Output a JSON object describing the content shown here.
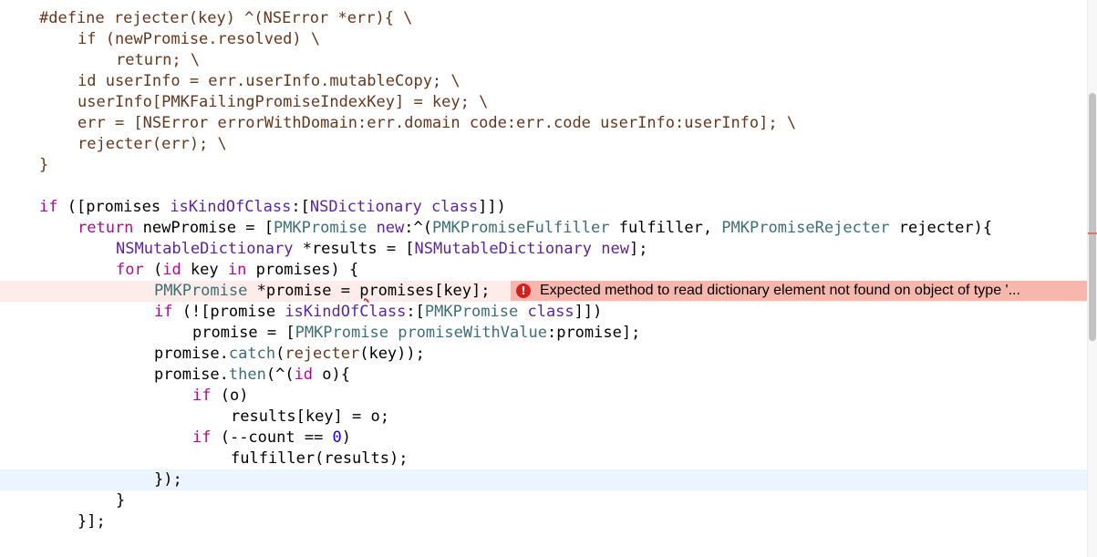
{
  "colors": {
    "error_line_bg": "#fdecea",
    "error_banner_bg": "#f7b7ad",
    "error_icon": "#d61f1f",
    "current_line_bg": "#ecf5ff",
    "preprocessor": "#643820",
    "keyword": "#aa0d91",
    "type": "#5c2699",
    "project_symbol": "#3f6e74",
    "number": "#1c00cf"
  },
  "editor": {
    "lines": [
      {
        "indent": 0,
        "tokens": [
          {
            "c": "pp",
            "t": "#define rejecter(key) ^(NSError *err){ \\"
          }
        ]
      },
      {
        "indent": 1,
        "tokens": [
          {
            "c": "pp",
            "t": "if (newPromise.resolved) \\"
          }
        ]
      },
      {
        "indent": 2,
        "tokens": [
          {
            "c": "pp",
            "t": "return; \\"
          }
        ]
      },
      {
        "indent": 1,
        "tokens": [
          {
            "c": "pp",
            "t": "id userInfo = err.userInfo.mutableCopy; \\"
          }
        ]
      },
      {
        "indent": 1,
        "tokens": [
          {
            "c": "pp",
            "t": "userInfo[PMKFailingPromiseIndexKey] = key; \\"
          }
        ]
      },
      {
        "indent": 1,
        "tokens": [
          {
            "c": "pp",
            "t": "err = [NSError errorWithDomain:err.domain code:err.code userInfo:userInfo]; \\"
          }
        ]
      },
      {
        "indent": 1,
        "tokens": [
          {
            "c": "pp",
            "t": "rejecter(err); \\"
          }
        ]
      },
      {
        "indent": 0,
        "tokens": [
          {
            "c": "pp",
            "t": "}"
          }
        ]
      },
      {
        "indent": 0,
        "tokens": []
      },
      {
        "indent": 0,
        "tokens": [
          {
            "c": "kw",
            "t": "if"
          },
          {
            "c": "pl",
            "t": " ([promises "
          },
          {
            "c": "ty",
            "t": "isKindOfClass"
          },
          {
            "c": "pl",
            "t": ":["
          },
          {
            "c": "ty",
            "t": "NSDictionary"
          },
          {
            "c": "pl",
            "t": " "
          },
          {
            "c": "ty",
            "t": "class"
          },
          {
            "c": "pl",
            "t": "]])"
          }
        ]
      },
      {
        "indent": 1,
        "tokens": [
          {
            "c": "kw",
            "t": "return"
          },
          {
            "c": "pl",
            "t": " newPromise = ["
          },
          {
            "c": "pr",
            "t": "PMKPromise"
          },
          {
            "c": "pl",
            "t": " "
          },
          {
            "c": "ty",
            "t": "new"
          },
          {
            "c": "pl",
            "t": ":^("
          },
          {
            "c": "pr",
            "t": "PMKPromiseFulfiller"
          },
          {
            "c": "pl",
            "t": " fulfiller, "
          },
          {
            "c": "pr",
            "t": "PMKPromiseRejecter"
          },
          {
            "c": "pl",
            "t": " rejecter){"
          }
        ]
      },
      {
        "indent": 2,
        "tokens": [
          {
            "c": "ty",
            "t": "NSMutableDictionary"
          },
          {
            "c": "pl",
            "t": " *results = ["
          },
          {
            "c": "ty",
            "t": "NSMutableDictionary"
          },
          {
            "c": "pl",
            "t": " "
          },
          {
            "c": "ty",
            "t": "new"
          },
          {
            "c": "pl",
            "t": "];"
          }
        ]
      },
      {
        "indent": 2,
        "tokens": [
          {
            "c": "kw",
            "t": "for"
          },
          {
            "c": "pl",
            "t": " ("
          },
          {
            "c": "kw",
            "t": "id"
          },
          {
            "c": "pl",
            "t": " key "
          },
          {
            "c": "kw",
            "t": "in"
          },
          {
            "c": "pl",
            "t": " promises) {"
          }
        ]
      },
      {
        "indent": 3,
        "error": true,
        "tokens": [
          {
            "c": "pr",
            "t": "PMKPromise"
          },
          {
            "c": "pl",
            "t": " *promise = "
          },
          {
            "c": "pl",
            "t": "p",
            "squiggle": true
          },
          {
            "c": "pl",
            "t": "romises[key];"
          }
        ]
      },
      {
        "indent": 3,
        "tokens": [
          {
            "c": "kw",
            "t": "if"
          },
          {
            "c": "pl",
            "t": " (![promise "
          },
          {
            "c": "ty",
            "t": "isKindOfClass"
          },
          {
            "c": "pl",
            "t": ":["
          },
          {
            "c": "pr",
            "t": "PMKPromise"
          },
          {
            "c": "pl",
            "t": " "
          },
          {
            "c": "ty",
            "t": "class"
          },
          {
            "c": "pl",
            "t": "]])"
          }
        ]
      },
      {
        "indent": 4,
        "tokens": [
          {
            "c": "pl",
            "t": "promise = ["
          },
          {
            "c": "pr",
            "t": "PMKPromise"
          },
          {
            "c": "pl",
            "t": " "
          },
          {
            "c": "pr",
            "t": "promiseWithValue"
          },
          {
            "c": "pl",
            "t": ":promise];"
          }
        ]
      },
      {
        "indent": 3,
        "tokens": [
          {
            "c": "pl",
            "t": "promise."
          },
          {
            "c": "pr",
            "t": "catch"
          },
          {
            "c": "pl",
            "t": "("
          },
          {
            "c": "pp",
            "t": "rejecter"
          },
          {
            "c": "pl",
            "t": "(key));"
          }
        ]
      },
      {
        "indent": 3,
        "tokens": [
          {
            "c": "pl",
            "t": "promise."
          },
          {
            "c": "pr",
            "t": "then"
          },
          {
            "c": "pl",
            "t": "(^("
          },
          {
            "c": "kw",
            "t": "id"
          },
          {
            "c": "pl",
            "t": " o){"
          }
        ]
      },
      {
        "indent": 4,
        "tokens": [
          {
            "c": "kw",
            "t": "if"
          },
          {
            "c": "pl",
            "t": " (o)"
          }
        ]
      },
      {
        "indent": 5,
        "tokens": [
          {
            "c": "pl",
            "t": "results[key] = o;"
          }
        ]
      },
      {
        "indent": 4,
        "tokens": [
          {
            "c": "kw",
            "t": "if"
          },
          {
            "c": "pl",
            "t": " (--count == "
          },
          {
            "c": "num",
            "t": "0"
          },
          {
            "c": "pl",
            "t": ")"
          }
        ]
      },
      {
        "indent": 5,
        "tokens": [
          {
            "c": "pl",
            "t": "fulfiller(results);"
          }
        ]
      },
      {
        "indent": 3,
        "current": true,
        "tokens": [
          {
            "c": "pl",
            "t": "});"
          }
        ]
      },
      {
        "indent": 2,
        "tokens": [
          {
            "c": "pl",
            "t": "}"
          }
        ]
      },
      {
        "indent": 1,
        "tokens": [
          {
            "c": "pl",
            "t": "}];"
          }
        ]
      }
    ],
    "error_banner": {
      "icon": "error-circle-icon",
      "icon_glyph": "!",
      "message": "Expected method to read dictionary element not found on object of type '..."
    }
  }
}
